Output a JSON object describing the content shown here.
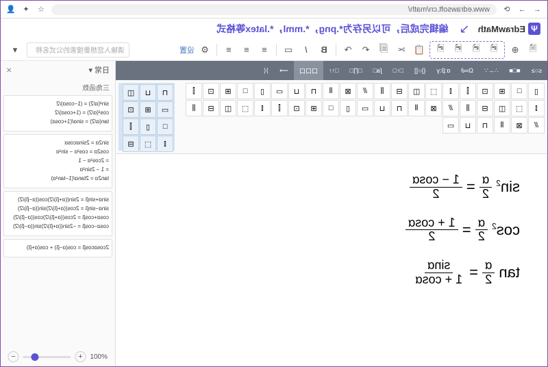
{
  "browser": {
    "url": "www.edrawsoft.cn/math/"
  },
  "app": {
    "logo_text": "EdrawMath",
    "logo_glyph": "Ψ",
    "promo": "编辑完成后，可以另存为*.png，*.mml，*.latex等格式"
  },
  "toolbar": {
    "settings": "设置"
  },
  "search": {
    "placeholder": "请输入您想要搜索的公式名称"
  },
  "symbol_tabs": [
    "≤○≥",
    "■□■",
    "∴←∵",
    "Ω∞∂",
    "α:β:γ",
    "{}○[]",
    "□↑□",
    "∫a□",
    "□∏□",
    "□↑↑",
    "口口口",
    "⟶",
    "⟩⟨"
  ],
  "equations": {
    "eq1_lhs_sup": "2",
    "eq1_lhs_fn": "sin",
    "eq1_frac_top": "α",
    "eq1_frac_bot": "2",
    "eq1_rhs_top": "1 − cosα",
    "eq1_rhs_bot": "2",
    "eq2_lhs_sup": "2",
    "eq2_lhs_fn": "cos",
    "eq2_frac_top": "α",
    "eq2_frac_bot": "2",
    "eq2_rhs_top": "1 + cosα",
    "eq2_rhs_bot": "2",
    "eq3_lhs_fn": "tan",
    "eq3_frac_top": "α",
    "eq3_frac_bot": "2",
    "eq3_rhs_top": "sinα",
    "eq3_rhs_bot": "1 + cosα"
  },
  "sidebar": {
    "category": "日常 ▾",
    "panel": "三角函数",
    "close": "×"
  },
  "formula_cards": [
    [
      "sin²(α/2) = (1−cosα)/2",
      "cos²(α/2) = (1+cosα)/2",
      "tan(α/2) = sinα/(1+cosα)"
    ],
    [
      "sin2α = 2sinαcosα",
      "cos2α = cos²α − sin²α",
      "= 2cos²α − 1",
      "= 1 − 2sin²α",
      "tan2α = 2tanα/(1−tan²α)"
    ],
    [
      "sinα+sinβ = 2sin((α+β)/2)cos((α−β)/2)",
      "sinα−sinβ = 2cos((α+β)/2)sin((α−β)/2)",
      "cosα+cosβ = 2cos((α+β)/2)cos((α−β)/2)",
      "cosα−cosβ = −2sin((α+β)/2)sin((α−β)/2)"
    ],
    [
      "2cosαcosβ = cos(α−β) + cos(α+β)"
    ]
  ],
  "zoom": {
    "value": "100%"
  }
}
